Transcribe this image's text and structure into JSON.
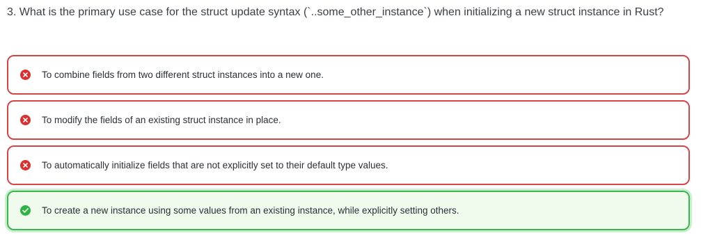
{
  "question": {
    "text": "3. What is the primary use case for the struct update syntax (`..some_other_instance`) when initializing a new struct instance in Rust?"
  },
  "options": [
    {
      "text": "To combine fields from two different struct instances into a new one.",
      "status": "incorrect",
      "icon": "x-circle-icon"
    },
    {
      "text": "To modify the fields of an existing struct instance in place.",
      "status": "incorrect",
      "icon": "x-circle-icon"
    },
    {
      "text": "To automatically initialize fields that are not explicitly set to their default type values.",
      "status": "incorrect",
      "icon": "x-circle-icon"
    },
    {
      "text": "To create a new instance using some values from an existing instance, while explicitly setting others.",
      "status": "correct",
      "icon": "check-circle-icon"
    }
  ],
  "colors": {
    "incorrect": "#dc2f2f",
    "correct": "#2fb344",
    "correct_background": "#f0fbee"
  }
}
